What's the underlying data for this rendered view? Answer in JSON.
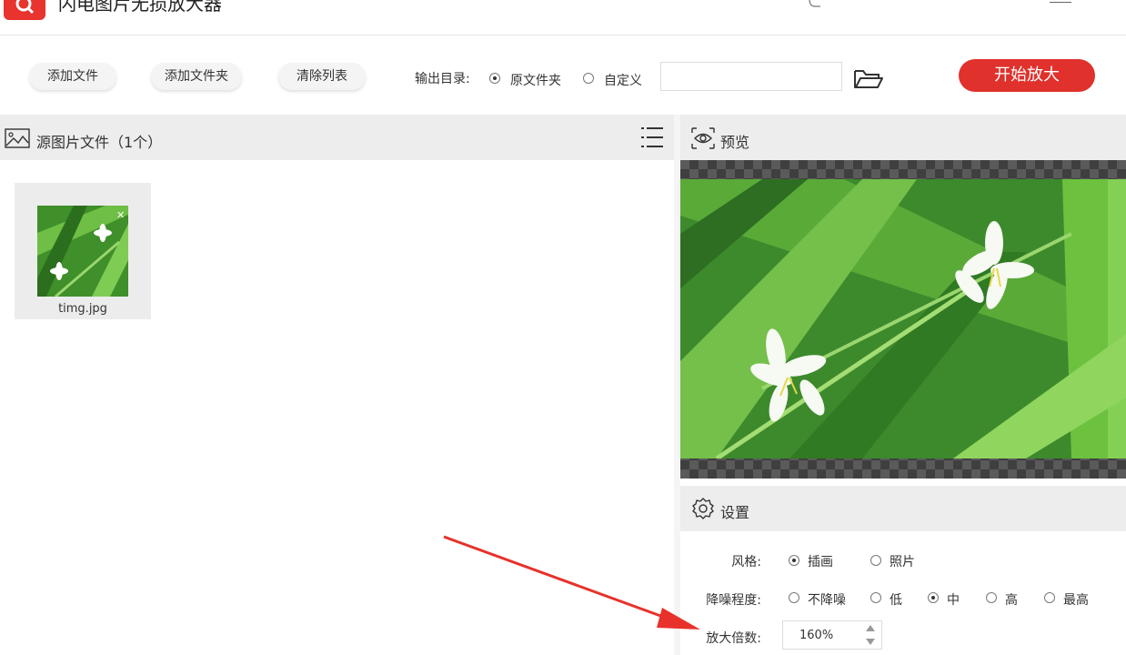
{
  "app": {
    "title": "闪电图片无损放大器"
  },
  "toolbar": {
    "add_file": "添加文件",
    "add_folder": "添加文件夹",
    "clear_list": "清除列表",
    "output_dir_label": "输出目录:",
    "output_options": [
      "原文件夹",
      "自定义"
    ],
    "output_selected": "原文件夹",
    "custom_path_value": "",
    "start_button": "开始放大"
  },
  "source_panel": {
    "title": "源图片文件（1个）",
    "files": [
      {
        "name": "timg.jpg"
      }
    ]
  },
  "preview_panel": {
    "title": "预览"
  },
  "settings": {
    "title": "设置",
    "style_label": "风格:",
    "style_options": [
      "插画",
      "照片"
    ],
    "style_selected": "插画",
    "denoise_label": "降噪程度:",
    "denoise_options": [
      "不降噪",
      "低",
      "中",
      "高",
      "最高"
    ],
    "denoise_selected": "中",
    "zoom_label": "放大倍数:",
    "zoom_value": "160%"
  },
  "colors": {
    "accent": "#e0312c",
    "annotation_arrow": "#e8312a"
  },
  "icons": [
    "app-logo-icon",
    "image-icon",
    "list-menu-icon",
    "folder-open-icon",
    "eye-icon",
    "gear-icon",
    "close-icon"
  ]
}
